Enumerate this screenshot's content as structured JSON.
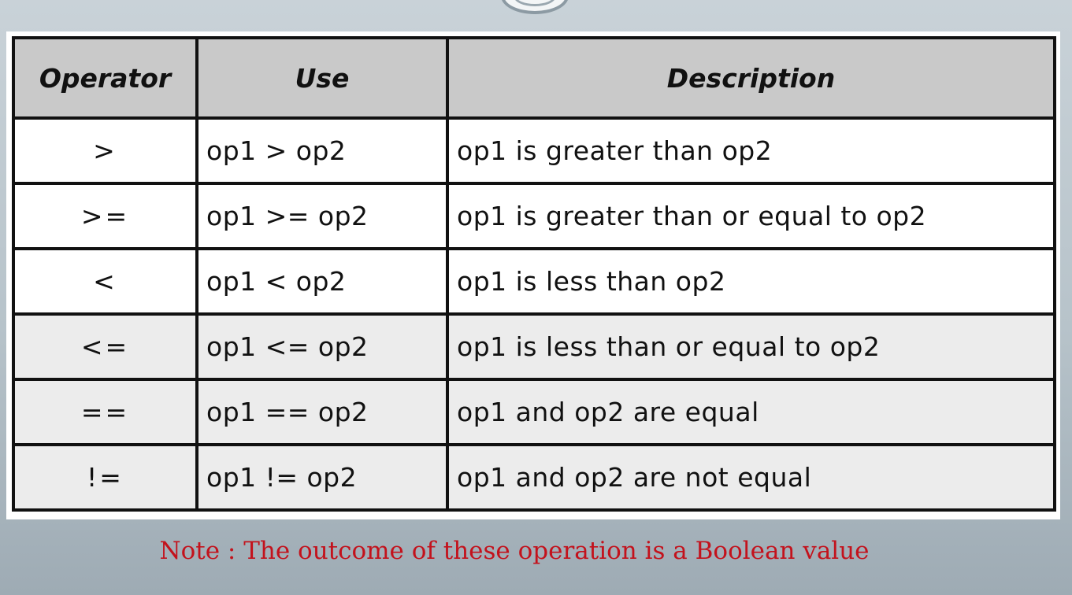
{
  "table": {
    "headers": {
      "operator": "Operator",
      "use": "Use",
      "description": "Description"
    },
    "rows": [
      {
        "operator": ">",
        "use": "op1 > op2",
        "description": "op1 is greater than op2"
      },
      {
        "operator": ">=",
        "use": "op1 >= op2",
        "description": "op1 is greater than or equal to op2"
      },
      {
        "operator": "<",
        "use": "op1 < op2",
        "description": "op1 is less than op2"
      },
      {
        "operator": "<=",
        "use": "op1 <= op2",
        "description": "op1 is less than or equal to op2"
      },
      {
        "operator": "==",
        "use": "op1 == op2",
        "description": "op1 and op2 are equal"
      },
      {
        "operator": "!=",
        "use": "op1 != op2",
        "description": "op1 and op2 are not equal"
      }
    ]
  },
  "note": "Note : The outcome of these operation is a Boolean value",
  "colors": {
    "note_text": "#c3121c",
    "header_background": "#c9c9c9",
    "border": "#111111"
  }
}
